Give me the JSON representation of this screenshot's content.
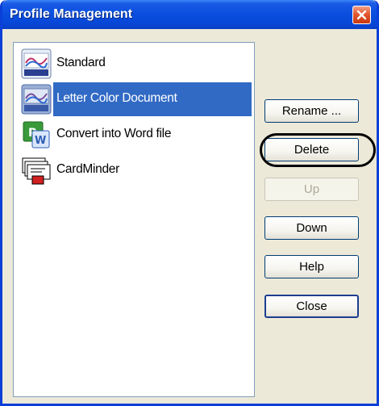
{
  "window": {
    "title": "Profile Management",
    "close_icon": "close-icon"
  },
  "colors": {
    "title_bar": "#0a4fdf",
    "selection": "#316ac5",
    "close_button": "#e2582f",
    "disabled_text": "#aca899"
  },
  "profiles": [
    {
      "label": "Standard",
      "icon": "standard-profile-icon",
      "selected": false
    },
    {
      "label": "Letter Color Document",
      "icon": "letter-color-document-icon",
      "selected": true
    },
    {
      "label": "Convert into Word file",
      "icon": "word-file-icon",
      "selected": false
    },
    {
      "label": "CardMinder",
      "icon": "cardminder-icon",
      "selected": false
    }
  ],
  "buttons": {
    "rename": "Rename ...",
    "delete": "Delete",
    "up": "Up",
    "down": "Down",
    "help": "Help",
    "close": "Close"
  },
  "annotation": {
    "highlighted_button": "delete"
  }
}
